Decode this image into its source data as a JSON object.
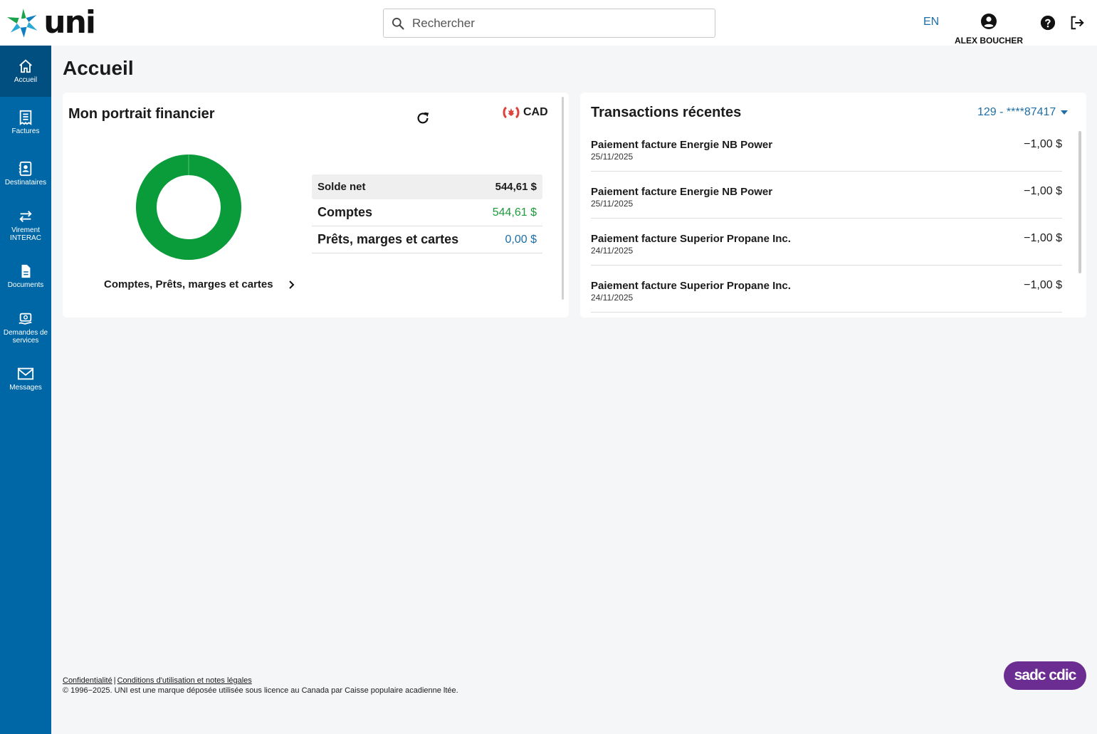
{
  "header": {
    "brand": "uni",
    "search_placeholder": "Rechercher",
    "lang": "EN",
    "user_name": "ALEX BOUCHER"
  },
  "sidebar": {
    "items": [
      {
        "label": "Accueil",
        "icon": "home-icon",
        "active": true
      },
      {
        "label": "Factures",
        "icon": "receipt-icon",
        "active": false
      },
      {
        "label": "Destinataires",
        "icon": "contacts-icon",
        "active": false
      },
      {
        "label": "Virement INTERAC",
        "icon": "transfer-icon",
        "active": false
      },
      {
        "label": "Documents",
        "icon": "document-icon",
        "active": false
      },
      {
        "label": "Demandes de services",
        "icon": "service-icon",
        "active": false
      },
      {
        "label": "Messages",
        "icon": "mail-icon",
        "active": false
      }
    ]
  },
  "main": {
    "title": "Accueil"
  },
  "portrait": {
    "title": "Mon portrait financier",
    "currency": "CAD",
    "chart_link": "Comptes, Prêts, marges et cartes",
    "net_label": "Solde net",
    "net_value": "544,61 $",
    "comptes_label": "Comptes",
    "comptes_value": "544,61 $",
    "prets_label": "Prêts, marges et cartes",
    "prets_value": "0,00 $"
  },
  "chart_data": {
    "type": "pie",
    "categories": [
      "Comptes",
      "Prêts, marges et cartes"
    ],
    "values": [
      544.61,
      0.0
    ],
    "title": "",
    "colors": [
      "#0a9b3a",
      "#1e6ea6"
    ]
  },
  "transactions": {
    "title": "Transactions récentes",
    "account": "129 - ****87417",
    "rows": [
      {
        "name": "Paiement facture Energie NB Power",
        "date": "25/11/2025",
        "amount": "−1,00 $"
      },
      {
        "name": "Paiement facture Energie NB Power",
        "date": "25/11/2025",
        "amount": "−1,00 $"
      },
      {
        "name": "Paiement facture Superior Propane Inc.",
        "date": "24/11/2025",
        "amount": "−1,00 $"
      },
      {
        "name": "Paiement facture Superior Propane Inc.",
        "date": "24/11/2025",
        "amount": "−1,00 $"
      }
    ]
  },
  "footer": {
    "privacy": "Confidentialité",
    "sep": "|",
    "terms": "Conditions d'utilisation et notes légales",
    "copyright": "© 1996−2025. UNI est une marque déposée utilisée sous licence au Canada par Caisse populaire acadienne ltée.",
    "cdic": "sadc cdic"
  },
  "colors": {
    "sidebar": "#0067a6",
    "sidebar_active": "#004f80",
    "accent_blue": "#1e6ea6",
    "positive_green": "#1e9a3c",
    "cdic_purple": "#6b2d91"
  }
}
